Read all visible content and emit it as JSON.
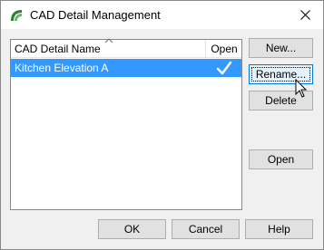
{
  "window": {
    "title": "CAD Detail Management",
    "close_glyph": "close-icon"
  },
  "list": {
    "columns": {
      "name": "CAD Detail Name",
      "open": "Open"
    },
    "sort_indicator": "sort-ascending-icon",
    "rows": [
      {
        "name": "Kitchen Elevation A",
        "open": true,
        "selected": true
      }
    ]
  },
  "buttons": {
    "new": "New...",
    "rename": "Rename...",
    "delete": "Delete",
    "open": "Open",
    "ok": "OK",
    "cancel": "Cancel",
    "help": "Help"
  },
  "colors": {
    "selection": "#3399ff",
    "focus_border": "#0078d7",
    "window_bg": "#f0f0f0"
  }
}
